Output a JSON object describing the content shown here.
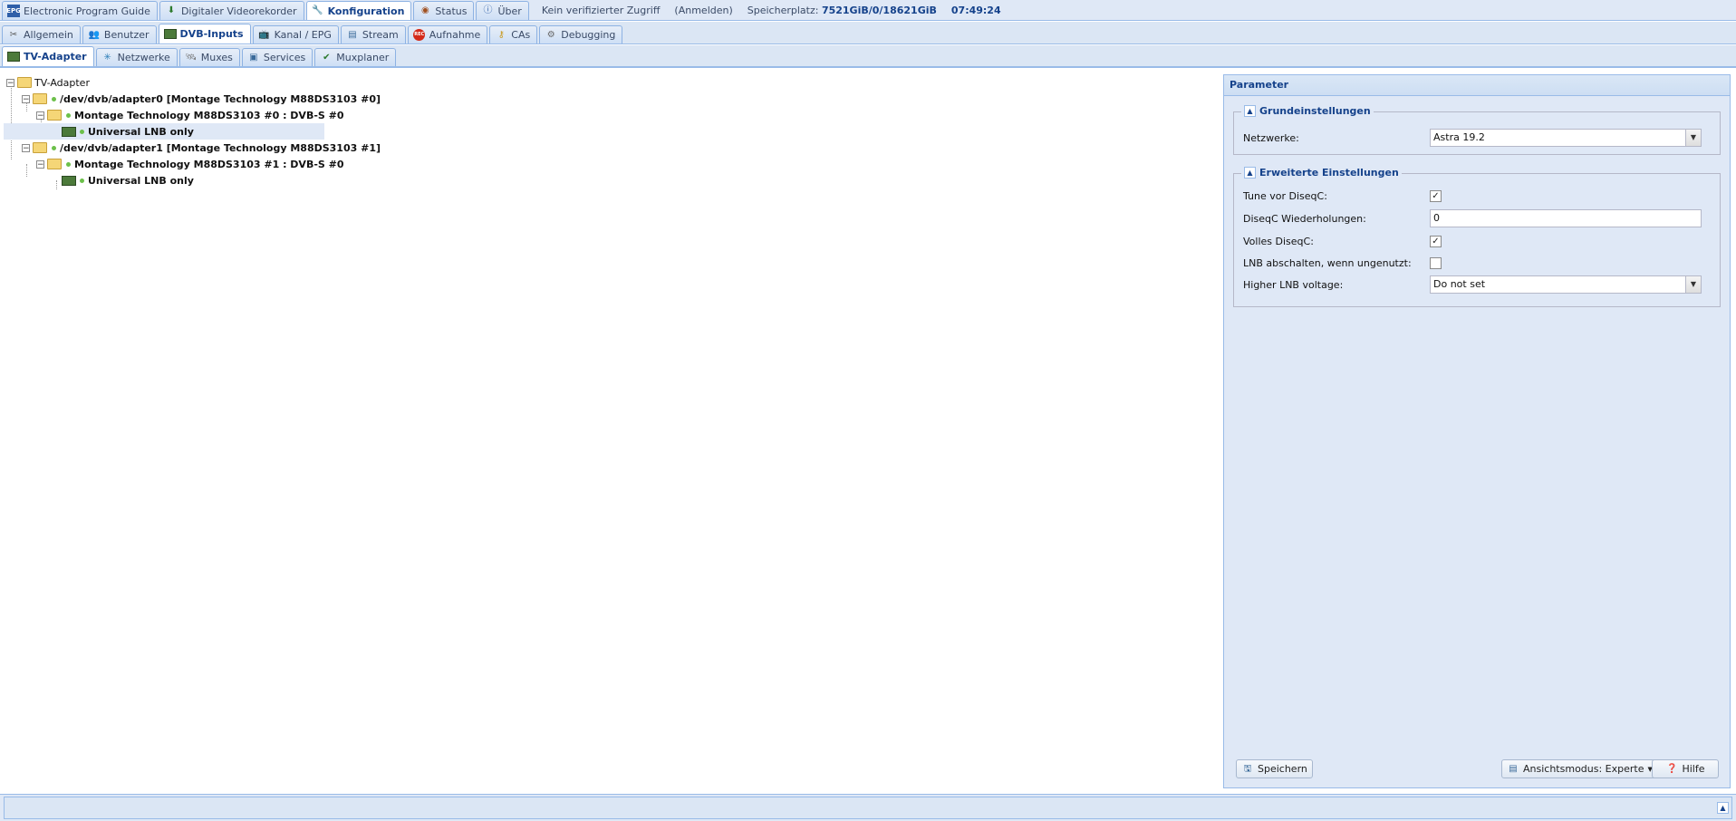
{
  "top_tabs": [
    {
      "label": "Electronic Program Guide",
      "icon": "epg-icon"
    },
    {
      "label": "Digitaler Videorekorder",
      "icon": "download-icon"
    },
    {
      "label": "Konfiguration",
      "icon": "wrench-icon",
      "active": true
    },
    {
      "label": "Status",
      "icon": "eye-icon"
    },
    {
      "label": "Über",
      "icon": "info-icon"
    }
  ],
  "status": {
    "access": "Kein verifizierter Zugriff",
    "login": "(Anmelden)",
    "storage_label": "Speicherplatz:",
    "storage_value": "7521GiB/0/18621GiB",
    "time": "07:49:24"
  },
  "config_tabs": [
    {
      "label": "Allgemein",
      "icon": "tools-icon"
    },
    {
      "label": "Benutzer",
      "icon": "users-icon"
    },
    {
      "label": "DVB-Inputs",
      "icon": "tv-card-icon",
      "active": true
    },
    {
      "label": "Kanal / EPG",
      "icon": "tv-icon"
    },
    {
      "label": "Stream",
      "icon": "stream-icon"
    },
    {
      "label": "Aufnahme",
      "icon": "rec-icon"
    },
    {
      "label": "CAs",
      "icon": "key-icon"
    },
    {
      "label": "Debugging",
      "icon": "gears-icon"
    }
  ],
  "dvb_tabs": [
    {
      "label": "TV-Adapter",
      "icon": "tv-card-icon",
      "active": true
    },
    {
      "label": "Netzwerke",
      "icon": "antenna-icon"
    },
    {
      "label": "Muxes",
      "icon": "satellite-icon"
    },
    {
      "label": "Services",
      "icon": "services-icon"
    },
    {
      "label": "Muxplaner",
      "icon": "scheduler-icon"
    }
  ],
  "tree": {
    "root": "TV-Adapter",
    "adapter0": "/dev/dvb/adapter0 [Montage Technology M88DS3103 #0]",
    "frontend0": "Montage Technology M88DS3103 #0 : DVB-S #0",
    "lnb0": "Universal LNB only",
    "adapter1": "/dev/dvb/adapter1 [Montage Technology M88DS3103 #1]",
    "frontend1": "Montage Technology M88DS3103 #1 : DVB-S #0",
    "lnb1": "Universal LNB only"
  },
  "panel": {
    "title": "Parameter",
    "basic": {
      "legend": "Grundeinstellungen",
      "networks_label": "Netzwerke:",
      "networks_value": "Astra 19.2"
    },
    "advanced": {
      "legend": "Erweiterte Einstellungen",
      "tune_before_diseqc_label": "Tune vor DiseqC:",
      "tune_before_diseqc": true,
      "diseqc_repeats_label": "DiseqC Wiederholungen:",
      "diseqc_repeats_value": "0",
      "full_diseqc_label": "Volles DiseqC:",
      "full_diseqc": true,
      "lnb_poweroff_label": "LNB abschalten, wenn ungenutzt:",
      "lnb_poweroff": false,
      "higher_voltage_label": "Higher LNB voltage:",
      "higher_voltage_value": "Do not set"
    },
    "save_label": "Speichern",
    "view_mode_label": "Ansichtsmodus: Experte",
    "help_label": "Hilfe"
  }
}
